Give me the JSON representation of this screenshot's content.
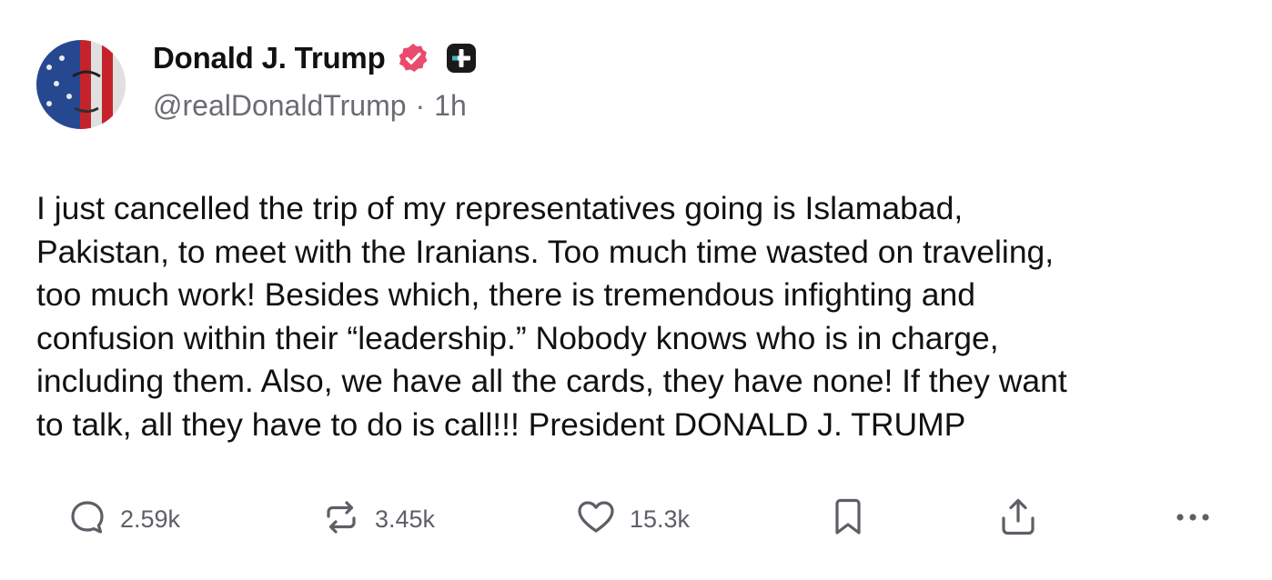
{
  "author": {
    "display_name": "Donald J. Trump",
    "handle": "@realDonaldTrump",
    "separator": "·",
    "time": "1h",
    "verified_color": "#e94b6e"
  },
  "post": {
    "text": "I just cancelled the trip of my representatives going is Islamabad,\nPakistan, to meet with the Iranians. Too much time wasted on traveling,\ntoo much work! Besides which, there is tremendous infighting and\nconfusion within their “leadership.” Nobody knows who is in charge,\nincluding them. Also, we have all the cards, they have none! If they want\nto talk, all they have to do is call!!! President DONALD J. TRUMP"
  },
  "actions": {
    "reply_count": "2.59k",
    "repost_count": "3.45k",
    "like_count": "15.3k"
  },
  "icons": {
    "verified": "verified-badge-icon",
    "plus": "plus-badge-icon",
    "reply": "reply-bubble-icon",
    "repost": "repost-arrows-icon",
    "like": "heart-icon",
    "bookmark": "bookmark-icon",
    "share": "share-upload-icon",
    "more": "more-dots-icon"
  }
}
